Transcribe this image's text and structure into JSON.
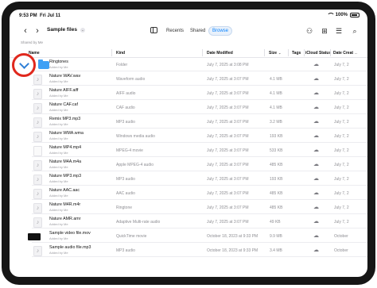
{
  "status": {
    "time": "9:53 PM",
    "date": "Fri Jul 11",
    "battery": "100%"
  },
  "toolbar": {
    "title": "Sample files",
    "tabs": [
      {
        "label": "Recents",
        "active": false
      },
      {
        "label": "Shared",
        "active": false
      },
      {
        "label": "Browse",
        "active": true
      }
    ],
    "icons": [
      "back-icon",
      "forward-icon",
      "sidebar-icon",
      "share-people-icon",
      "new-folder-icon",
      "list-view-icon",
      "search-icon"
    ]
  },
  "section": {
    "label": "Shared by Me"
  },
  "columns": {
    "name": "Name",
    "kind": "Kind",
    "date_modified": "Date Modified",
    "size": "Size",
    "tags": "Tags",
    "icloud_status": "iCloud Status",
    "date_created": "Date Creat"
  },
  "rows": [
    {
      "name": "Ringtones",
      "sub": "Added by Me",
      "kind": "Folder",
      "date": "July 7, 2025 at 3:08 PM",
      "size": "",
      "date2": "July 7, 2",
      "thumb": "folder"
    },
    {
      "name": "Nature WAV.wav",
      "sub": "Added by Me",
      "kind": "Waveform audio",
      "date": "July 7, 2025 at 3:07 PM",
      "size": "4.1 MB",
      "date2": "July 7, 2",
      "thumb": "audio"
    },
    {
      "name": "Nature AIFF.aiff",
      "sub": "Added by Me",
      "kind": "AIFF audio",
      "date": "July 7, 2025 at 3:07 PM",
      "size": "4.1 MB",
      "date2": "July 7, 2",
      "thumb": "audio"
    },
    {
      "name": "Nature CAF.caf",
      "sub": "Added by Me",
      "kind": "CAF audio",
      "date": "July 7, 2025 at 3:07 PM",
      "size": "4.1 MB",
      "date2": "July 7, 2",
      "thumb": "audio"
    },
    {
      "name": "Remix MP3.mp3",
      "sub": "Added by Me",
      "kind": "MP3 audio",
      "date": "July 7, 2025 at 3:07 PM",
      "size": "3.2 MB",
      "date2": "July 7, 2",
      "thumb": "audio"
    },
    {
      "name": "Nature WMA.wma",
      "sub": "Added by Me",
      "kind": "Windows media audio",
      "date": "July 7, 2025 at 3:07 PM",
      "size": "193 KB",
      "date2": "July 7, 2",
      "thumb": "audio"
    },
    {
      "name": "Nature MP4.mp4",
      "sub": "Added by Me",
      "kind": "MPEG-4 movie",
      "date": "July 7, 2025 at 3:07 PM",
      "size": "533 KB",
      "date2": "July 7, 2",
      "thumb": "doc"
    },
    {
      "name": "Nature M4A.m4a",
      "sub": "Added by Me",
      "kind": "Apple MPEG-4 audio",
      "date": "July 7, 2025 at 3:07 PM",
      "size": "485 KB",
      "date2": "July 7, 2",
      "thumb": "audio"
    },
    {
      "name": "Nature MP3.mp3",
      "sub": "Added by Me",
      "kind": "MP3 audio",
      "date": "July 7, 2025 at 3:07 PM",
      "size": "193 KB",
      "date2": "July 7, 2",
      "thumb": "audio"
    },
    {
      "name": "Nature AAC.aac",
      "sub": "Added by Me",
      "kind": "AAC audio",
      "date": "July 7, 2025 at 3:07 PM",
      "size": "485 KB",
      "date2": "July 7, 2",
      "thumb": "audio"
    },
    {
      "name": "Nature M4R.m4r",
      "sub": "Added by Me",
      "kind": "Ringtone",
      "date": "July 7, 2025 at 3:07 PM",
      "size": "485 KB",
      "date2": "July 7, 2",
      "thumb": "audio"
    },
    {
      "name": "Nature AMR.amr",
      "sub": "Added by Me",
      "kind": "Adaptive Multi-rate audio",
      "date": "July 7, 2025 at 3:07 PM",
      "size": "49 KB",
      "date2": "July 7, 2",
      "thumb": "audio"
    },
    {
      "name": "Sample video file.mov",
      "sub": "Added by Me",
      "kind": "QuickTime movie",
      "date": "October 18, 2023 at 9:33 PM",
      "size": "9.9 MB",
      "date2": "October",
      "thumb": "video"
    },
    {
      "name": "Sample audio file.mp3",
      "sub": "Added by Me",
      "kind": "MP3 audio",
      "date": "October 18, 2023 at 9:33 PM",
      "size": "3.4 MB",
      "date2": "October",
      "thumb": "audio"
    }
  ]
}
